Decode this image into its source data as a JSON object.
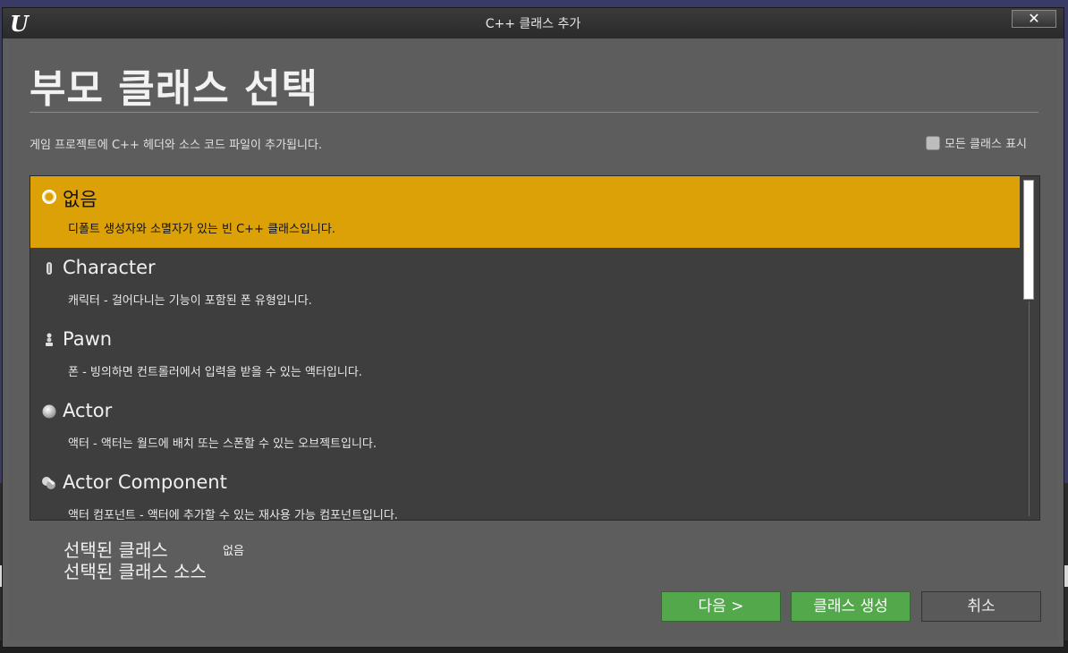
{
  "window": {
    "title": "C++ 클래스 추가",
    "close_label": "✕",
    "logo_text": "U"
  },
  "header": {
    "title": "부모 클래스 선택",
    "subtitle": "게임 프로젝트에 C++ 헤더와 소스 코드 파일이 추가됩니다.",
    "show_all_label": "모든 클래스 표시"
  },
  "classes": [
    {
      "name": "없음",
      "desc": "디폴트 생성자와 소멸자가 있는 빈 C++ 클래스입니다.",
      "icon": "none-circle-icon",
      "selected": true
    },
    {
      "name": "Character",
      "desc": "캐릭터 - 걸어다니는 기능이 포함된 폰 유형입니다.",
      "icon": "character-icon",
      "selected": false
    },
    {
      "name": "Pawn",
      "desc": "폰 - 빙의하면 컨트롤러에서 입력을 받을 수 있는 액터입니다.",
      "icon": "pawn-icon",
      "selected": false
    },
    {
      "name": "Actor",
      "desc": "액터 - 액터는 월드에 배치 또는 스폰할 수 있는 오브젝트입니다.",
      "icon": "actor-sphere-icon",
      "selected": false
    },
    {
      "name": "Actor Component",
      "desc": "액터 컴포넌트 - 액터에 추가할 수 있는 재사용 가능 컴포넌트입니다.",
      "icon": "actor-component-icon",
      "selected": false
    }
  ],
  "selection": {
    "class_label": "선택된 클래스",
    "source_label": "선택된 클래스 소스",
    "class_value": "없음"
  },
  "buttons": {
    "next": "다음 >",
    "create": "클래스 생성",
    "cancel": "취소"
  },
  "colors": {
    "selected_row": "#dca106",
    "primary_button": "#54a84c"
  }
}
